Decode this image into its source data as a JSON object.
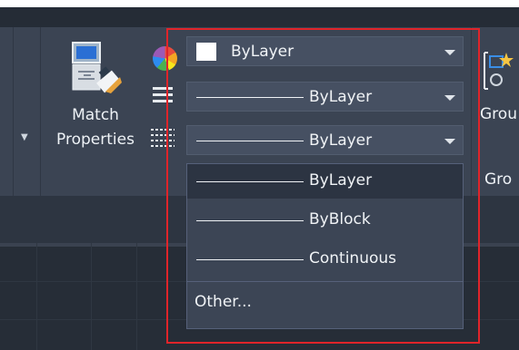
{
  "ribbon": {
    "match_properties": {
      "line1": "Match",
      "line2": "Properties"
    },
    "color_combo": {
      "value": "ByLayer",
      "swatch_color": "#ffffff"
    },
    "lineweight_combo": {
      "value": "ByLayer"
    },
    "linetype_combo": {
      "value": "ByLayer"
    },
    "group_labels": {
      "group_button": "Grou",
      "group_panel": "Gro"
    }
  },
  "linetype_dropdown": {
    "items": [
      {
        "label": "ByLayer",
        "selected": true
      },
      {
        "label": "ByBlock",
        "selected": false
      },
      {
        "label": "Continuous",
        "selected": false
      }
    ],
    "other_label": "Other..."
  },
  "colors": {
    "ribbon_bg": "#3b4453",
    "combo_bg": "#465062",
    "dropdown_bg": "#3c4555",
    "selected_bg": "#2c3442",
    "highlight": "#e0242a"
  },
  "icons": [
    "match-properties-icon",
    "color-wheel-icon",
    "lineweight-icon",
    "linetype-icon",
    "dropdown-arrow-icon",
    "group-icon"
  ]
}
